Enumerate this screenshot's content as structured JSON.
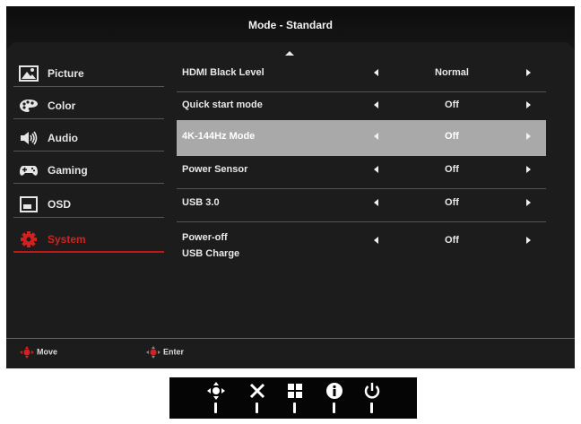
{
  "header": {
    "title": "Mode - Standard"
  },
  "sidebar": {
    "items": [
      {
        "label": "Picture",
        "icon": "picture-icon"
      },
      {
        "label": "Color",
        "icon": "palette-icon"
      },
      {
        "label": "Audio",
        "icon": "speaker-icon"
      },
      {
        "label": "Gaming",
        "icon": "gamepad-icon"
      },
      {
        "label": "OSD",
        "icon": "osd-window-icon"
      },
      {
        "label": "System",
        "icon": "gear-icon",
        "active": true
      }
    ]
  },
  "settings": {
    "rows": [
      {
        "label": "HDMI Black Level",
        "value": "Normal"
      },
      {
        "label": "Quick start mode",
        "value": "Off"
      },
      {
        "label": "4K-144Hz Mode",
        "value": "Off",
        "highlighted": true
      },
      {
        "label": "Power Sensor",
        "value": "Off"
      },
      {
        "label": "USB 3.0",
        "value": "Off"
      },
      {
        "label": "Power-off\nUSB Charge",
        "value": "Off"
      }
    ]
  },
  "footer": {
    "move_label": "Move",
    "enter_label": "Enter"
  },
  "buttons": [
    "joystick-icon",
    "close-icon",
    "grid-icon",
    "info-icon",
    "power-icon"
  ],
  "colors": {
    "accent": "#d42020",
    "highlight": "#a9a9a9",
    "panel": "#1c1c1c"
  }
}
